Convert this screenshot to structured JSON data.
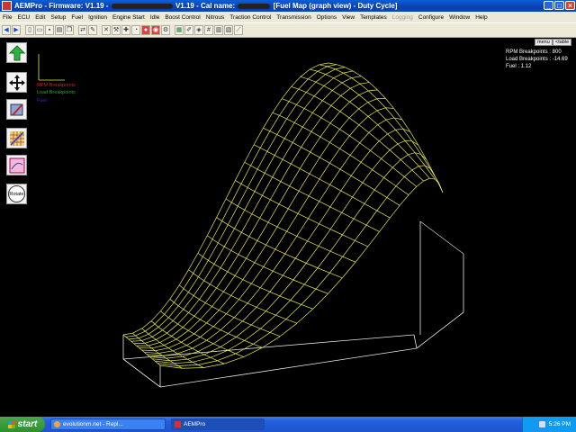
{
  "window": {
    "title_prefix": "AEMPro - Firmware: V1.19 -",
    "title_mid": "V1.19 - Cal name:",
    "title_suffix": "[Fuel Map (graph view) - Duty Cycle]",
    "controls": [
      "_",
      "□",
      "×"
    ]
  },
  "menu": [
    "File",
    "ECU",
    "Edit",
    "Setup",
    "Fuel",
    "Ignition",
    "Engine Start",
    "Idle",
    "Boost Control",
    "Nitrous",
    "Traction Control",
    "Transmission",
    "Options",
    "View",
    "Templates",
    "Logging",
    "Configure",
    "Window",
    "Help"
  ],
  "menu_disabled": [
    "Logging"
  ],
  "sidebar": {
    "rotate_label": "Rotate"
  },
  "graph": {
    "legend": {
      "rpm": "RPM Breakpoints",
      "load": "Load Breakpoints",
      "fuel": "Fuel",
      "rpm_color": "#cc2222",
      "load_color": "#22aa22",
      "fuel_color": "#2233cc"
    },
    "buttons": {
      "menu": "menu",
      "table": "<table"
    },
    "readout": {
      "rpm": "RPM Breakpoints : 800",
      "load": "Load Breakpoints : -14.69",
      "fuel": "Fuel : 1.12"
    },
    "mesh_color": "#e8e85a",
    "box_color": "#e8e8e8"
  },
  "taskbar": {
    "start": "start",
    "tasks": [
      "evolutionm.net - Repl...",
      "AEMPro"
    ],
    "clock": "5:26 PM"
  }
}
